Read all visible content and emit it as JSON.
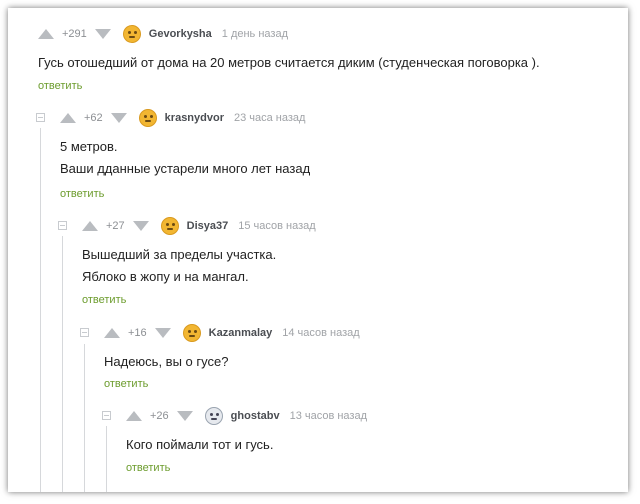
{
  "comments": [
    {
      "rating": "+291",
      "nick": "Gevorkysha",
      "time": "1 день назад",
      "lines": [
        "Гусь отошедший от дома на 20 метров считается диким (студенческая поговорка )."
      ],
      "reply": "ответить",
      "avatar": "avatar-icon"
    },
    {
      "rating": "+62",
      "nick": "krasnydvor",
      "time": "23 часа назад",
      "lines": [
        "5 метров.",
        "Ваши дданные устарели много лет назад"
      ],
      "reply": "ответить",
      "avatar": "avatar-icon"
    },
    {
      "rating": "+27",
      "nick": "Disya37",
      "time": "15 часов назад",
      "lines": [
        "Вышедший за пределы участка.",
        "Яблоко в жопу и на мангал."
      ],
      "reply": "ответить",
      "avatar": "avatar-icon"
    },
    {
      "rating": "+16",
      "nick": "Kazanmalay",
      "time": "14 часов назад",
      "lines": [
        "Надеюсь, вы о гусе?"
      ],
      "reply": "ответить",
      "avatar": "avatar-icon"
    },
    {
      "rating": "+26",
      "nick": "ghostabv",
      "time": "13 часов назад",
      "lines": [
        "Кого поймали тот и гусь."
      ],
      "reply": "ответить",
      "avatar": "avatar-icon"
    }
  ]
}
